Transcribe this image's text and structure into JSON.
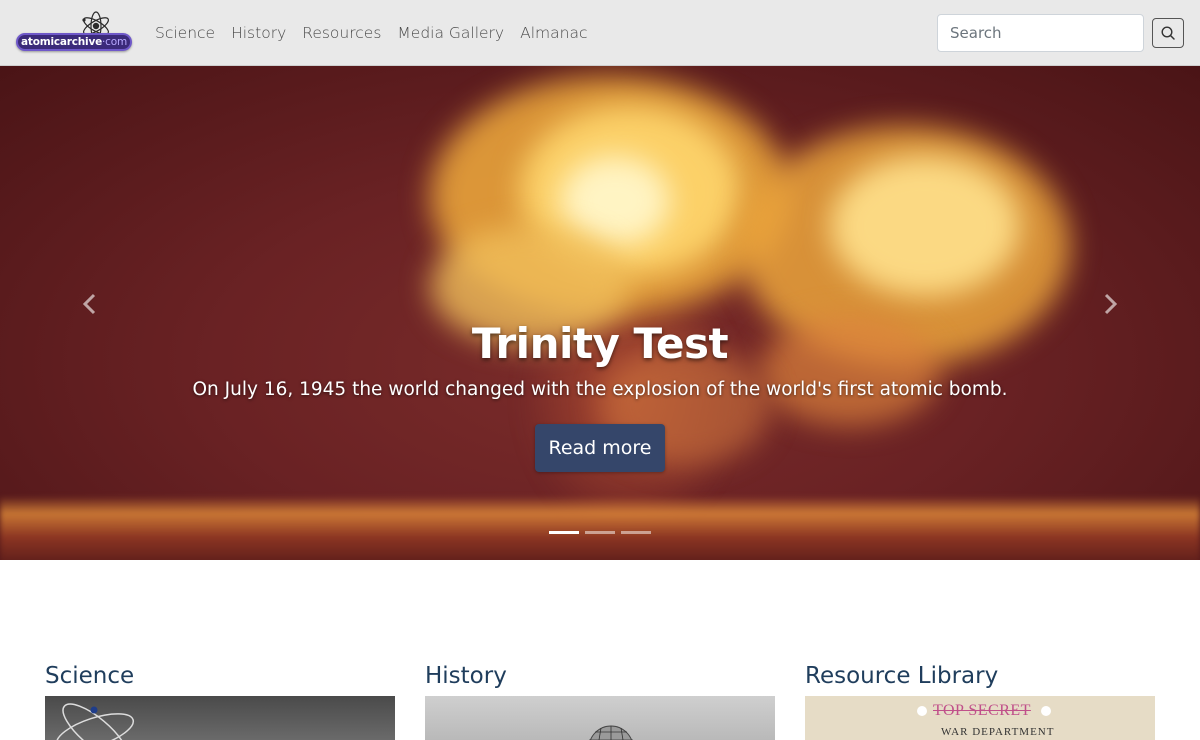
{
  "logo": {
    "text_main": "atomicarchive",
    "text_dot": "·",
    "text_tld": "com"
  },
  "nav": {
    "links": [
      {
        "label": "Science"
      },
      {
        "label": "History"
      },
      {
        "label": "Resources"
      },
      {
        "label": "Media Gallery"
      },
      {
        "label": "Almanac"
      }
    ]
  },
  "search": {
    "placeholder": "Search",
    "value": ""
  },
  "hero": {
    "title": "Trinity Test",
    "text": "On July 16, 1945 the world changed with the explosion of the world's first atomic bomb.",
    "button_label": "Read more",
    "active_slide": 1,
    "slide_count": 3
  },
  "sections": [
    {
      "title": "Science"
    },
    {
      "title": "History"
    },
    {
      "title": "Resource Library"
    }
  ],
  "resource_image": {
    "stamp": "TOP SECRET",
    "dept": "WAR DEPARTMENT"
  },
  "colors": {
    "navbar_bg": "#e9e9e9",
    "accent_button": "#35466a",
    "section_title": "#1f3d5c",
    "logo_bg": "#3b2a7a"
  },
  "icons": {
    "search": "search-icon",
    "prev": "chevron-left-icon",
    "next": "chevron-right-icon",
    "logo_atom": "atom-icon"
  }
}
